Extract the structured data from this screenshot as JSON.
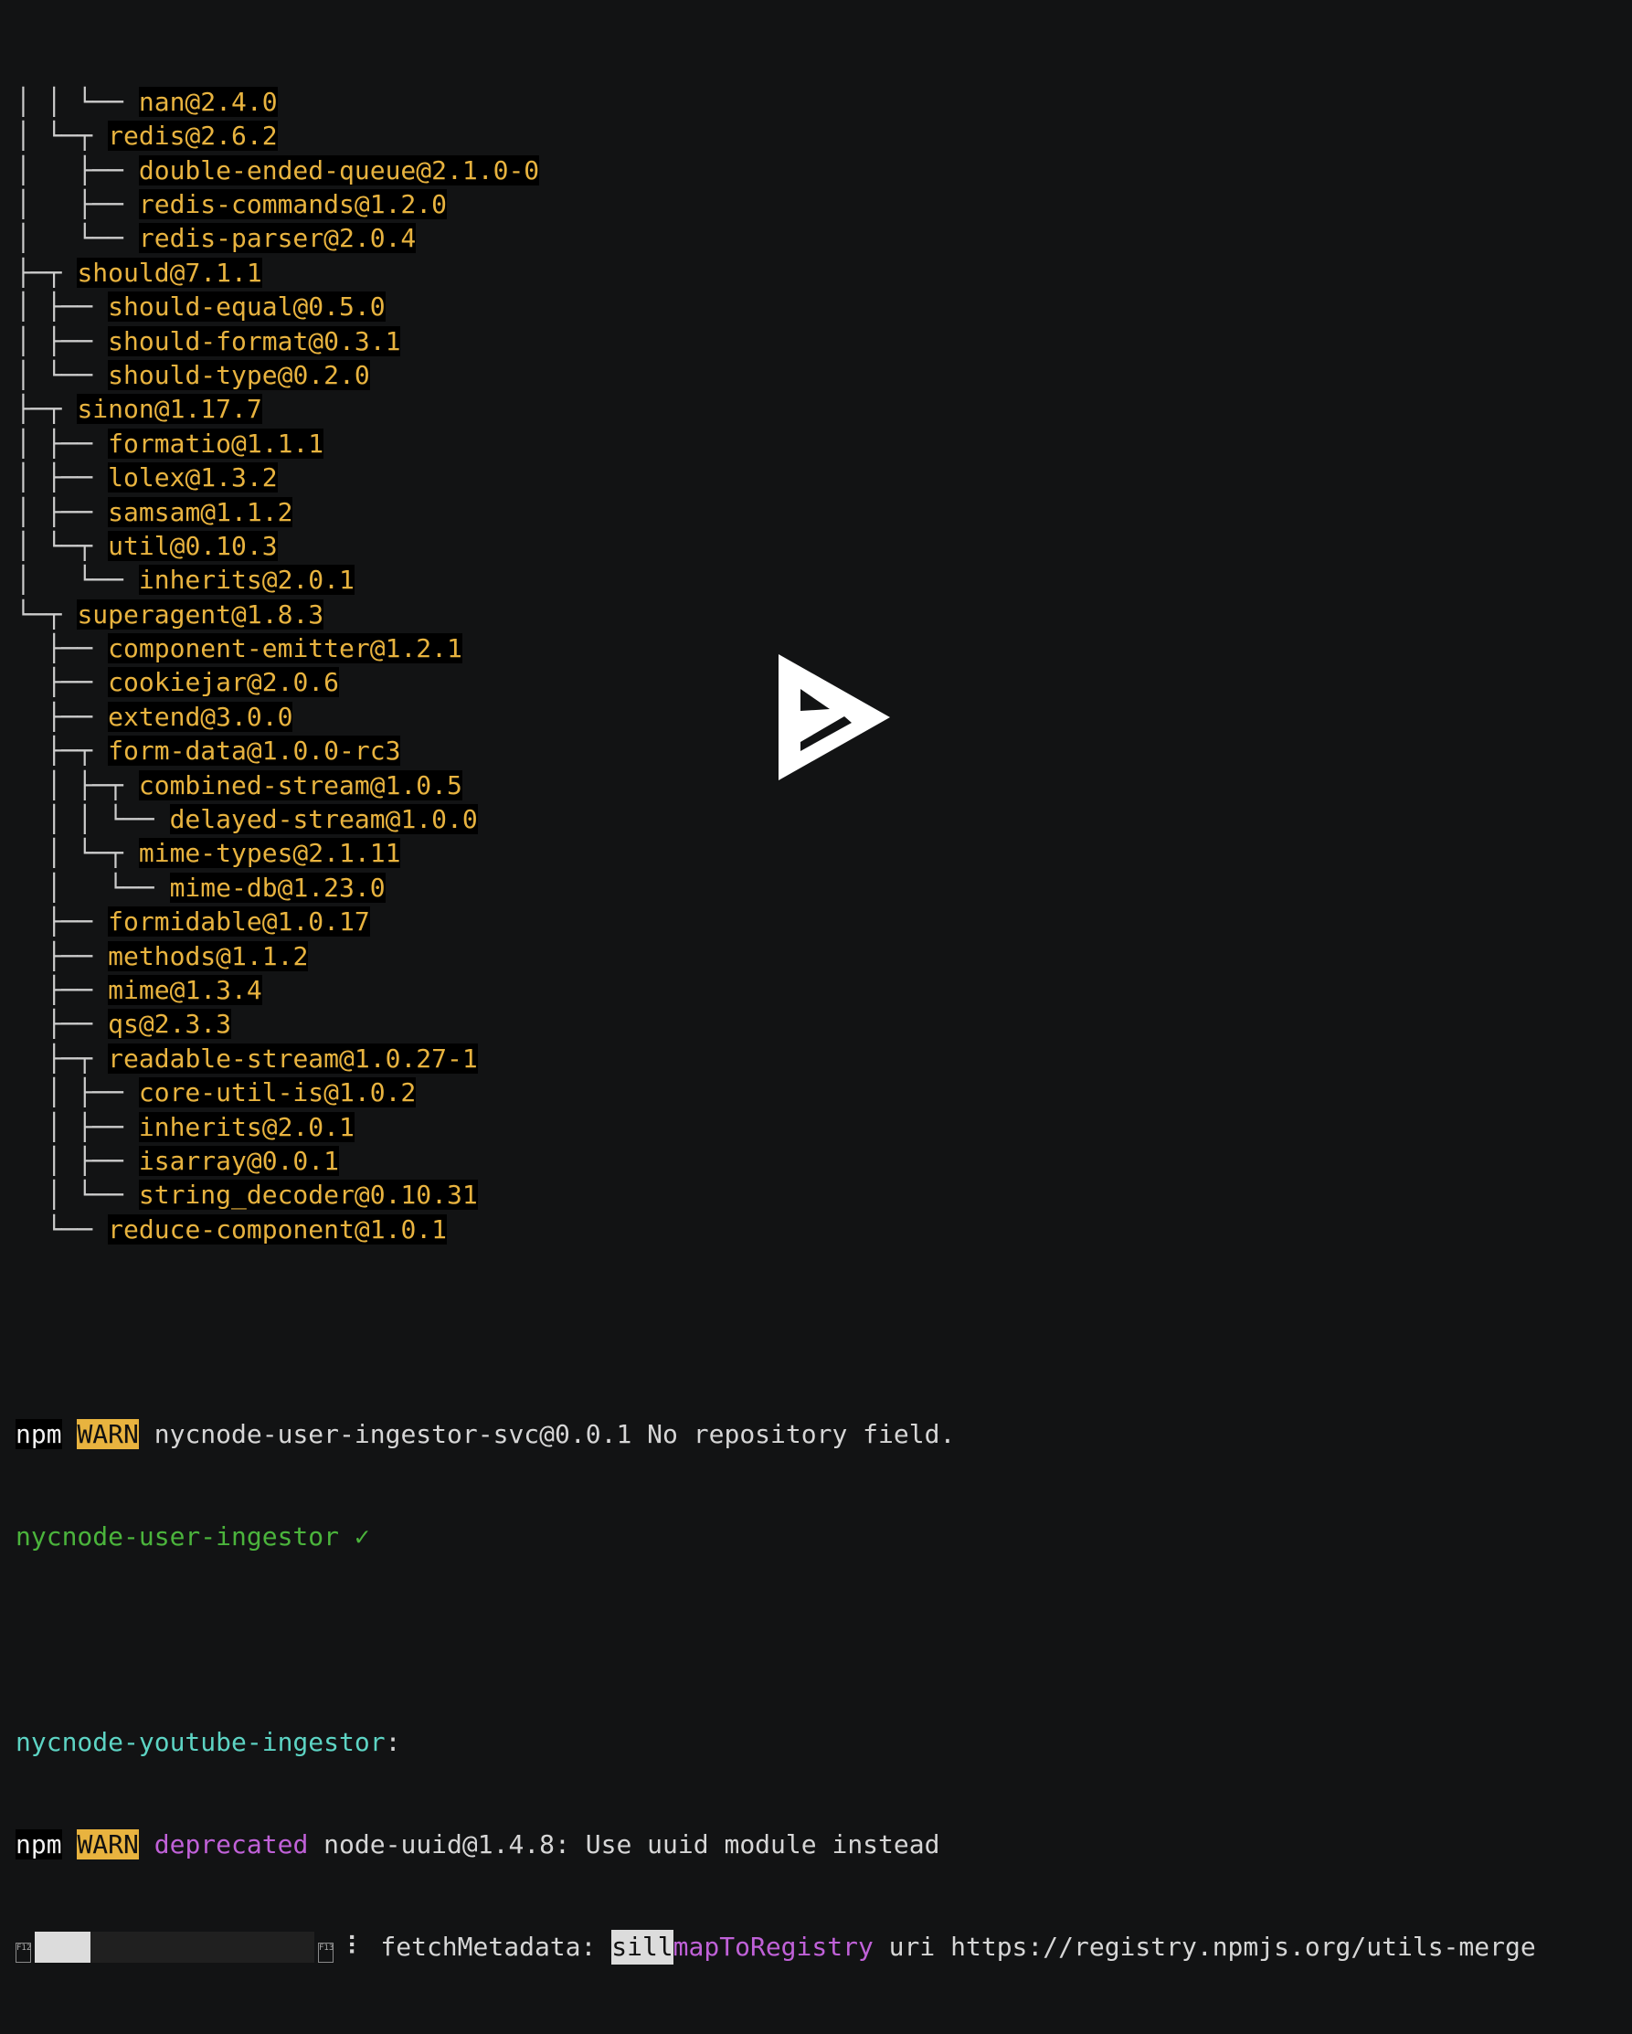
{
  "tree": [
    {
      "prefix": "│ │ └── ",
      "pkg": "nan@2.4.0"
    },
    {
      "prefix": "│ └─┬ ",
      "pkg": "redis@2.6.2"
    },
    {
      "prefix": "│   ├── ",
      "pkg": "double-ended-queue@2.1.0-0"
    },
    {
      "prefix": "│   ├── ",
      "pkg": "redis-commands@1.2.0"
    },
    {
      "prefix": "│   └── ",
      "pkg": "redis-parser@2.0.4"
    },
    {
      "prefix": "├─┬ ",
      "pkg": "should@7.1.1"
    },
    {
      "prefix": "│ ├── ",
      "pkg": "should-equal@0.5.0"
    },
    {
      "prefix": "│ ├── ",
      "pkg": "should-format@0.3.1"
    },
    {
      "prefix": "│ └── ",
      "pkg": "should-type@0.2.0"
    },
    {
      "prefix": "├─┬ ",
      "pkg": "sinon@1.17.7"
    },
    {
      "prefix": "│ ├── ",
      "pkg": "formatio@1.1.1"
    },
    {
      "prefix": "│ ├── ",
      "pkg": "lolex@1.3.2"
    },
    {
      "prefix": "│ ├── ",
      "pkg": "samsam@1.1.2"
    },
    {
      "prefix": "│ └─┬ ",
      "pkg": "util@0.10.3"
    },
    {
      "prefix": "│   └── ",
      "pkg": "inherits@2.0.1"
    },
    {
      "prefix": "└─┬ ",
      "pkg": "superagent@1.8.3"
    },
    {
      "prefix": "  ├── ",
      "pkg": "component-emitter@1.2.1"
    },
    {
      "prefix": "  ├── ",
      "pkg": "cookiejar@2.0.6"
    },
    {
      "prefix": "  ├── ",
      "pkg": "extend@3.0.0"
    },
    {
      "prefix": "  ├─┬ ",
      "pkg": "form-data@1.0.0-rc3"
    },
    {
      "prefix": "  │ ├─┬ ",
      "pkg": "combined-stream@1.0.5"
    },
    {
      "prefix": "  │ │ └── ",
      "pkg": "delayed-stream@1.0.0"
    },
    {
      "prefix": "  │ └─┬ ",
      "pkg": "mime-types@2.1.11"
    },
    {
      "prefix": "  │   └── ",
      "pkg": "mime-db@1.23.0"
    },
    {
      "prefix": "  ├── ",
      "pkg": "formidable@1.0.17"
    },
    {
      "prefix": "  ├── ",
      "pkg": "methods@1.1.2"
    },
    {
      "prefix": "  ├── ",
      "pkg": "mime@1.3.4"
    },
    {
      "prefix": "  ├── ",
      "pkg": "qs@2.3.3"
    },
    {
      "prefix": "  ├─┬ ",
      "pkg": "readable-stream@1.0.27-1"
    },
    {
      "prefix": "  │ ├── ",
      "pkg": "core-util-is@1.0.2"
    },
    {
      "prefix": "  │ ├── ",
      "pkg": "inherits@2.0.1"
    },
    {
      "prefix": "  │ ├── ",
      "pkg": "isarray@0.0.1"
    },
    {
      "prefix": "  │ └── ",
      "pkg": "string_decoder@0.10.31"
    },
    {
      "prefix": "  └── ",
      "pkg": "reduce-component@1.0.1"
    }
  ],
  "warn1": {
    "npm": "npm",
    "warn": "WARN",
    "message": " nycnode-user-ingestor-svc@0.0.1 No repository field."
  },
  "done_line": "nycnode-user-ingestor ✓",
  "section": {
    "name": "nycnode-youtube-ingestor",
    "colon": ":"
  },
  "warn2": {
    "npm": "npm",
    "warn": "WARN",
    "deprecated": "deprecated",
    "message": " node-uuid@1.4.8: Use uuid module instead"
  },
  "progress": {
    "left_glyph": "F12",
    "right_glyph": "F13",
    "fraction": 0.2,
    "spinner": "⠇",
    "label": " fetchMetadata: ",
    "level": "sill",
    "action": "mapToRegistry",
    "uri_text": " uri https://registry.npmjs.org/utils-merge"
  },
  "colors": {
    "background": "#121314",
    "package": "#e8b33f",
    "warn_bg": "#e8b33f",
    "success": "#4bb43c",
    "section": "#5dd4c4",
    "deprecated": "#c061d8"
  },
  "overlay_icon": "asciinema-play-icon"
}
